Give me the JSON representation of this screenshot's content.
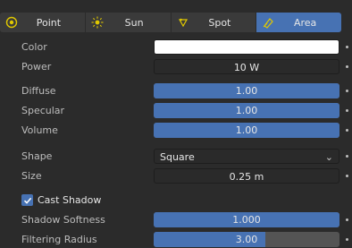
{
  "tabs": [
    {
      "label": "Point",
      "icon": "point-light-icon",
      "active": false
    },
    {
      "label": "Sun",
      "icon": "sun-light-icon",
      "active": false
    },
    {
      "label": "Spot",
      "icon": "spot-light-icon",
      "active": false
    },
    {
      "label": "Area",
      "icon": "area-light-icon",
      "active": true
    }
  ],
  "props": {
    "color_label": "Color",
    "color_value": "#ffffff",
    "power_label": "Power",
    "power_value": "10 W",
    "diffuse_label": "Diffuse",
    "diffuse_value": "1.00",
    "specular_label": "Specular",
    "specular_value": "1.00",
    "volume_label": "Volume",
    "volume_value": "1.00",
    "shape_label": "Shape",
    "shape_value": "Square",
    "size_label": "Size",
    "size_value": "0.25 m",
    "cast_shadow_label": "Cast Shadow",
    "cast_shadow_checked": true,
    "shadow_softness_label": "Shadow Softness",
    "shadow_softness_value": "1.000",
    "filtering_radius_label": "Filtering Radius",
    "filtering_radius_value": "3.00",
    "filtering_radius_fraction": 0.6
  },
  "colors": {
    "accent": "#4772b3",
    "panel": "#2b2b2b"
  }
}
